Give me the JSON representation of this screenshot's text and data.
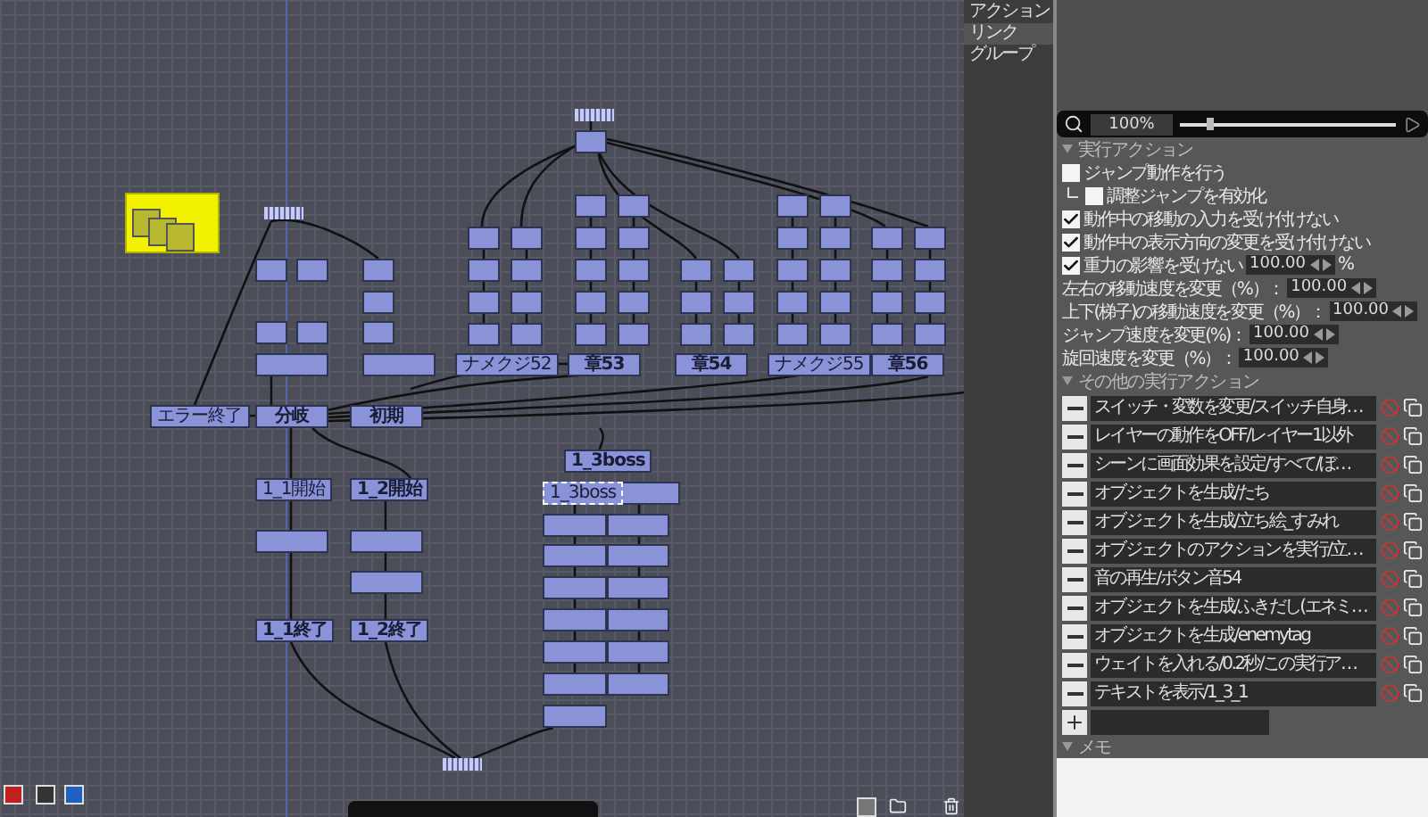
{
  "object_tree": {
    "items": [
      {
        "label": "アクション",
        "selected": false
      },
      {
        "label": "リンク",
        "selected": true
      },
      {
        "label": "グループ",
        "selected": false
      }
    ]
  },
  "canvas": {
    "nodes": [
      {
        "label": "エラー終了",
        "kind": "minor",
        "selected": false
      },
      {
        "label": "分岐",
        "kind": "major",
        "selected": false
      },
      {
        "label": "初期",
        "kind": "major",
        "selected": false
      },
      {
        "label": "1_1開始",
        "kind": "minor",
        "selected": false
      },
      {
        "label": "1_2開始",
        "kind": "major",
        "selected": false
      },
      {
        "label": "1_1終了",
        "kind": "major",
        "selected": false
      },
      {
        "label": "1_2終了",
        "kind": "major",
        "selected": false
      },
      {
        "label": "ナメクジ52",
        "kind": "minor",
        "selected": false
      },
      {
        "label": "章53",
        "kind": "major",
        "selected": false
      },
      {
        "label": "章54",
        "kind": "major",
        "selected": false
      },
      {
        "label": "ナメクジ55",
        "kind": "minor",
        "selected": false
      },
      {
        "label": "章56",
        "kind": "major",
        "selected": false
      },
      {
        "label": "1_3boss",
        "kind": "major",
        "selected": false
      },
      {
        "label": "1_3boss",
        "kind": "minor",
        "selected": true
      }
    ]
  },
  "zoom": {
    "value": "100%",
    "level": 0.14
  },
  "action_section": {
    "title": "実行アクション",
    "checkboxes": [
      {
        "label": "ジャンプ動作を行う",
        "checked": false,
        "indented": false
      },
      {
        "label": "調整ジャンプを有効化",
        "checked": false,
        "indented": true
      },
      {
        "label": "動作中の移動の入力を受け付けない",
        "checked": true,
        "indented": false
      },
      {
        "label": "動作中の表示方向の変更を受け付けない",
        "checked": true,
        "indented": false
      },
      {
        "label": "重力の影響を受けない",
        "checked": true,
        "indented": false,
        "value": "100.00",
        "unit": "%"
      }
    ],
    "fields": [
      {
        "label": "左右の移動速度を変更（%）：",
        "value": "100.00"
      },
      {
        "label": "上下(梯子)の移動速度を変更（%）：",
        "value": "100.00"
      },
      {
        "label": "ジャンプ速度を変更(%)：",
        "value": "100.00"
      },
      {
        "label": "旋回速度を変更（%）：",
        "value": "100.00"
      }
    ]
  },
  "other_actions": {
    "title": "その他の実行アクション",
    "items": [
      "スイッチ・変数を変更/スイッチ自身…",
      "レイヤーの動作をOFF/レイヤー1以外",
      "シーンに画面効果を設定/すべて/ぼ…",
      "オブジェクトを生成/たち",
      "オブジェクトを生成/立ち絵_すみれ",
      "オブジェクトのアクションを実行/立…",
      "音の再生/ボタン音54",
      "オブジェクトを生成/ふきだし(エネミ…",
      "オブジェクトを生成/enemytag",
      "ウェイトを入れる/0.2秒/この実行ア…",
      "テキストを表示/1_3_1"
    ]
  },
  "memo": {
    "title": "メモ"
  }
}
